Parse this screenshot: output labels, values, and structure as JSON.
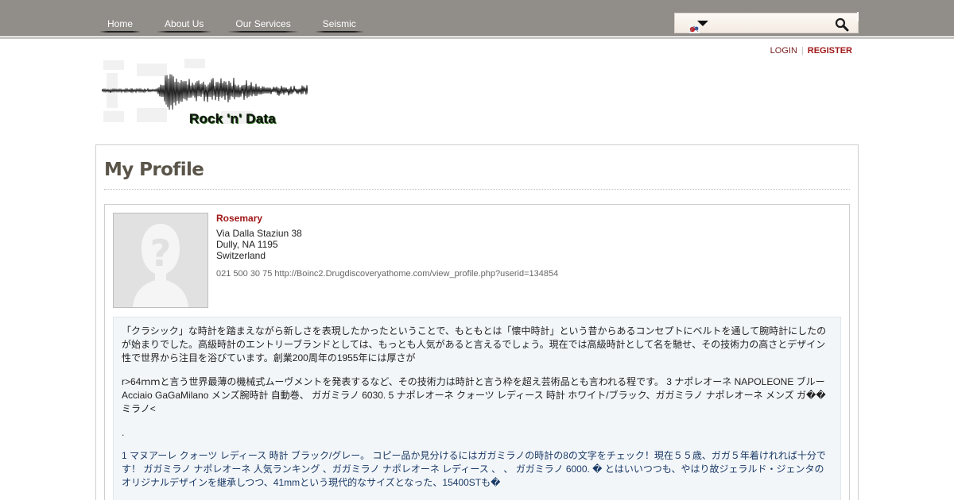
{
  "nav": {
    "items": [
      {
        "label": "Home"
      },
      {
        "label": "About Us"
      },
      {
        "label": "Our Services"
      },
      {
        "label": "Seismic"
      }
    ]
  },
  "search": {
    "placeholder": "",
    "value": "",
    "icon": "magnifier-icon"
  },
  "auth": {
    "login_label": "LOGIN",
    "separator": "|",
    "register_label": "REGISTER"
  },
  "logo": {
    "text": "Rock 'n' Data"
  },
  "page": {
    "title": "My Profile"
  },
  "profile": {
    "name": "Rosemary",
    "address_line1": "Via Dalla Staziun 38",
    "address_line2": "Dully, NA 1195",
    "country": "Switzerland",
    "contact": "021 500 30 75 http://Boinc2.Drugdiscoveryathome.com/view_profile.php?userid=134854",
    "avatar_icon": "default-avatar-icon"
  },
  "bio": {
    "paragraphs": [
      "「クラシック」な時計を踏まえながら新しさを表現したかったということで、もともとは「懐中時計」という昔からあるコンセプトにベルトを通して腕時計にしたのが始まりでした。高級時計のエントリーブランドとしては、もっとも人気があると言えるでしょう。現在では高級時計として名を馳せ、その技術力の高さとデザイン性で世界から注目を浴びています。創業200周年の1955年には厚さが",
      "r>64ｍｍと言う世界最薄の機械式ムーヴメントを発表するなど、その技術力は時計と言う枠を超え芸術品とも言われる程です。 3 ナポレオーネ NAPOLEONE ブルー Acciaio GaGaMilano メンズ腕時計 自動巻、 ガガミラノ 6030. 5 ナポレオーネ クォーツ レディース 時計 ホワイト/ブラック、ガガミラノ ナポレオーネ メンズ ガ�� ミラノ<",
      ".",
      "1 マヌアーレ クォーツ レディース 時計 ブラック/グレー。 コピー品か見分けるにはガガミラノの時計の8の文字をチェック！現在５５歳、ガガ５年着けれれば十分です！ ガガミラノ ナポレオーネ 人気ランキング 、ガガミラノ ナポレオーネ レディース 、 、 ガガミラノ 6000. � とはいいつつも、やはり故ジェラルド・ジェンタのオリジナルデザインを継承しつつ、41mmという現代的なサイズとなった、15400STも�"
    ]
  },
  "colors": {
    "topbar": "#918d89",
    "accent_red": "#a01818",
    "title_color": "#5a5449",
    "bio_background": "#f3f6f9"
  }
}
